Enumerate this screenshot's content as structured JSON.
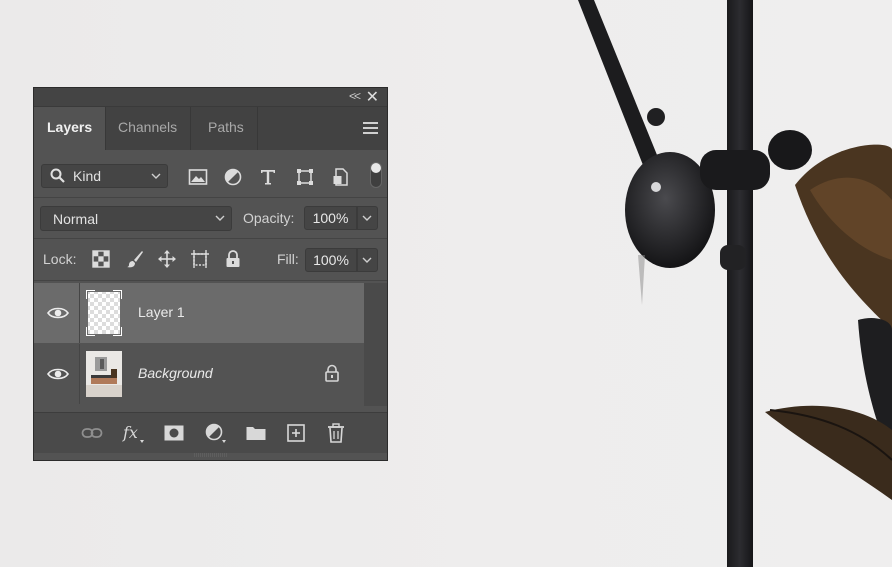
{
  "panel": {
    "collapse_icon": "double-chevron-left-icon",
    "close_icon": "close-icon",
    "tabs": [
      {
        "label": "Layers",
        "active": true
      },
      {
        "label": "Channels",
        "active": false
      },
      {
        "label": "Paths",
        "active": false
      }
    ],
    "menu_icon": "hamburger-menu-icon"
  },
  "filter": {
    "kind_label": "Kind",
    "icons": [
      "image-filter-icon",
      "adjustment-filter-icon",
      "type-filter-icon",
      "shape-filter-icon",
      "smart-object-filter-icon"
    ],
    "toggle_on": true
  },
  "blend": {
    "mode": "Normal",
    "opacity_label": "Opacity:",
    "opacity_value": "100%"
  },
  "lock": {
    "label": "Lock:",
    "icons": [
      "lock-transparent-pixels-icon",
      "lock-image-pixels-icon",
      "lock-position-icon",
      "lock-artboard-icon",
      "lock-all-icon"
    ],
    "fill_label": "Fill:",
    "fill_value": "100%"
  },
  "layers": [
    {
      "name": "Layer 1",
      "visible": true,
      "selected": true,
      "locked": false
    },
    {
      "name": "Background",
      "visible": true,
      "selected": false,
      "locked": true
    }
  ],
  "bottom_bar": {
    "icons": [
      "link-layers-icon",
      "fx-icon",
      "add-mask-icon",
      "adjustment-layer-icon",
      "new-group-icon",
      "new-layer-icon",
      "delete-icon"
    ]
  },
  "colors": {
    "panel_bg": "#535353",
    "tab_bar_bg": "#424242",
    "selected_row": "#6b6b6b",
    "text": "#eaeaea"
  }
}
